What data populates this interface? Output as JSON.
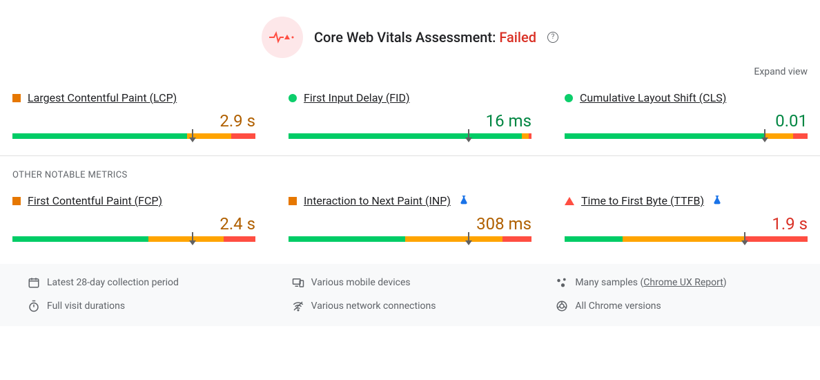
{
  "header": {
    "title_prefix": "Core Web Vitals Assessment: ",
    "status": "Failed"
  },
  "controls": {
    "expand_view": "Expand view"
  },
  "section_other_label": "OTHER NOTABLE METRICS",
  "metrics": {
    "lcp": {
      "name": "Largest Contentful Paint (LCP)",
      "value": "2.9 s",
      "status": "orange",
      "bar": {
        "g": 72,
        "o": 18,
        "r": 10,
        "marker": 74
      }
    },
    "fid": {
      "name": "First Input Delay (FID)",
      "value": "16 ms",
      "status": "green",
      "bar": {
        "g": 96,
        "o": 3,
        "r": 1,
        "marker": 74
      }
    },
    "cls": {
      "name": "Cumulative Layout Shift (CLS)",
      "value": "0.01",
      "status": "green",
      "bar": {
        "g": 82,
        "o": 12,
        "r": 6,
        "marker": 82
      }
    },
    "fcp": {
      "name": "First Contentful Paint (FCP)",
      "value": "2.4 s",
      "status": "orange",
      "bar": {
        "g": 56,
        "o": 31,
        "r": 13,
        "marker": 74
      }
    },
    "inp": {
      "name": "Interaction to Next Paint (INP)",
      "value": "308 ms",
      "status": "orange",
      "experimental": true,
      "bar": {
        "g": 48,
        "o": 40,
        "r": 12,
        "marker": 74
      }
    },
    "ttfb": {
      "name": "Time to First Byte (TTFB)",
      "value": "1.9 s",
      "status": "red",
      "experimental": true,
      "bar": {
        "g": 24,
        "o": 50,
        "r": 26,
        "marker": 74
      }
    }
  },
  "footer": {
    "period": "Latest 28-day collection period",
    "devices": "Various mobile devices",
    "samples_prefix": "Many samples (",
    "samples_link": "Chrome UX Report",
    "samples_suffix": ")",
    "durations": "Full visit durations",
    "network": "Various network connections",
    "versions": "All Chrome versions"
  }
}
